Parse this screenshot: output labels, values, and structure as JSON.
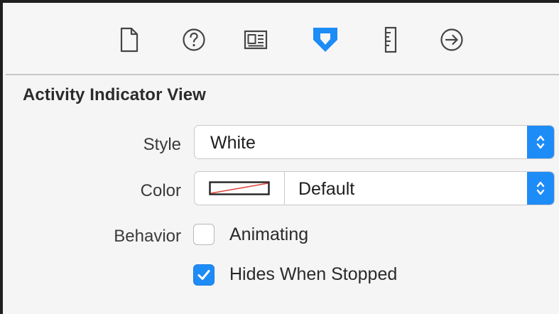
{
  "toolbar": {
    "items": [
      {
        "icon": "file-inspector-icon",
        "active": false
      },
      {
        "icon": "quick-help-icon",
        "active": false
      },
      {
        "icon": "identity-inspector-icon",
        "active": false
      },
      {
        "icon": "attributes-inspector-icon",
        "active": true
      },
      {
        "icon": "size-inspector-icon",
        "active": false
      },
      {
        "icon": "connections-inspector-icon",
        "active": false
      }
    ],
    "accent_color": "#1e8cf7"
  },
  "section": {
    "title": "Activity Indicator View"
  },
  "style_row": {
    "label": "Style",
    "value": "White"
  },
  "color_row": {
    "label": "Color",
    "value": "Default"
  },
  "behavior_row": {
    "label": "Behavior",
    "animating_label": "Animating",
    "animating_checked": false,
    "hides_label": "Hides When Stopped",
    "hides_checked": true
  }
}
